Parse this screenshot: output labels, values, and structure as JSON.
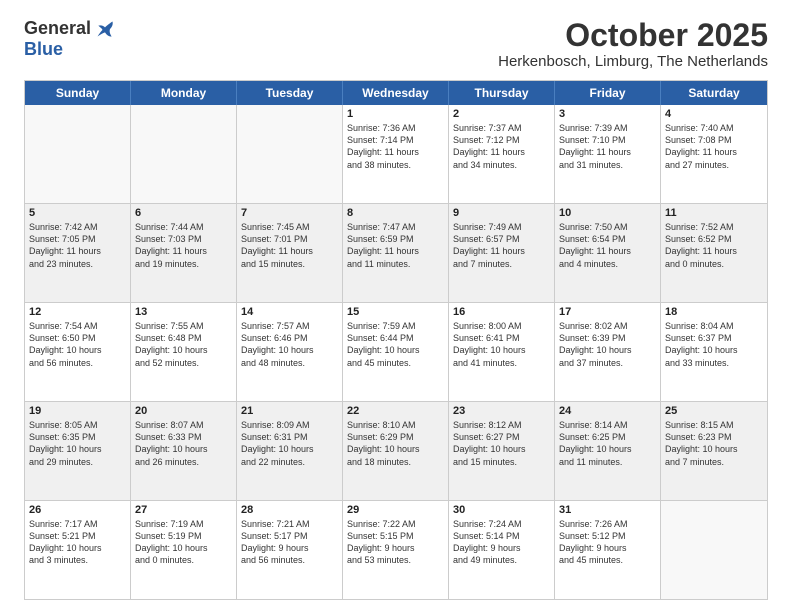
{
  "logo": {
    "general": "General",
    "blue": "Blue"
  },
  "title": "October 2025",
  "location": "Herkenbosch, Limburg, The Netherlands",
  "headers": [
    "Sunday",
    "Monday",
    "Tuesday",
    "Wednesday",
    "Thursday",
    "Friday",
    "Saturday"
  ],
  "weeks": [
    [
      {
        "day": "",
        "empty": true
      },
      {
        "day": "",
        "empty": true
      },
      {
        "day": "",
        "empty": true
      },
      {
        "day": "1",
        "lines": [
          "Sunrise: 7:36 AM",
          "Sunset: 7:14 PM",
          "Daylight: 11 hours",
          "and 38 minutes."
        ]
      },
      {
        "day": "2",
        "lines": [
          "Sunrise: 7:37 AM",
          "Sunset: 7:12 PM",
          "Daylight: 11 hours",
          "and 34 minutes."
        ]
      },
      {
        "day": "3",
        "lines": [
          "Sunrise: 7:39 AM",
          "Sunset: 7:10 PM",
          "Daylight: 11 hours",
          "and 31 minutes."
        ]
      },
      {
        "day": "4",
        "lines": [
          "Sunrise: 7:40 AM",
          "Sunset: 7:08 PM",
          "Daylight: 11 hours",
          "and 27 minutes."
        ]
      }
    ],
    [
      {
        "day": "5",
        "lines": [
          "Sunrise: 7:42 AM",
          "Sunset: 7:05 PM",
          "Daylight: 11 hours",
          "and 23 minutes."
        ]
      },
      {
        "day": "6",
        "lines": [
          "Sunrise: 7:44 AM",
          "Sunset: 7:03 PM",
          "Daylight: 11 hours",
          "and 19 minutes."
        ]
      },
      {
        "day": "7",
        "lines": [
          "Sunrise: 7:45 AM",
          "Sunset: 7:01 PM",
          "Daylight: 11 hours",
          "and 15 minutes."
        ]
      },
      {
        "day": "8",
        "lines": [
          "Sunrise: 7:47 AM",
          "Sunset: 6:59 PM",
          "Daylight: 11 hours",
          "and 11 minutes."
        ]
      },
      {
        "day": "9",
        "lines": [
          "Sunrise: 7:49 AM",
          "Sunset: 6:57 PM",
          "Daylight: 11 hours",
          "and 7 minutes."
        ]
      },
      {
        "day": "10",
        "lines": [
          "Sunrise: 7:50 AM",
          "Sunset: 6:54 PM",
          "Daylight: 11 hours",
          "and 4 minutes."
        ]
      },
      {
        "day": "11",
        "lines": [
          "Sunrise: 7:52 AM",
          "Sunset: 6:52 PM",
          "Daylight: 11 hours",
          "and 0 minutes."
        ]
      }
    ],
    [
      {
        "day": "12",
        "lines": [
          "Sunrise: 7:54 AM",
          "Sunset: 6:50 PM",
          "Daylight: 10 hours",
          "and 56 minutes."
        ]
      },
      {
        "day": "13",
        "lines": [
          "Sunrise: 7:55 AM",
          "Sunset: 6:48 PM",
          "Daylight: 10 hours",
          "and 52 minutes."
        ]
      },
      {
        "day": "14",
        "lines": [
          "Sunrise: 7:57 AM",
          "Sunset: 6:46 PM",
          "Daylight: 10 hours",
          "and 48 minutes."
        ]
      },
      {
        "day": "15",
        "lines": [
          "Sunrise: 7:59 AM",
          "Sunset: 6:44 PM",
          "Daylight: 10 hours",
          "and 45 minutes."
        ]
      },
      {
        "day": "16",
        "lines": [
          "Sunrise: 8:00 AM",
          "Sunset: 6:41 PM",
          "Daylight: 10 hours",
          "and 41 minutes."
        ]
      },
      {
        "day": "17",
        "lines": [
          "Sunrise: 8:02 AM",
          "Sunset: 6:39 PM",
          "Daylight: 10 hours",
          "and 37 minutes."
        ]
      },
      {
        "day": "18",
        "lines": [
          "Sunrise: 8:04 AM",
          "Sunset: 6:37 PM",
          "Daylight: 10 hours",
          "and 33 minutes."
        ]
      }
    ],
    [
      {
        "day": "19",
        "lines": [
          "Sunrise: 8:05 AM",
          "Sunset: 6:35 PM",
          "Daylight: 10 hours",
          "and 29 minutes."
        ]
      },
      {
        "day": "20",
        "lines": [
          "Sunrise: 8:07 AM",
          "Sunset: 6:33 PM",
          "Daylight: 10 hours",
          "and 26 minutes."
        ]
      },
      {
        "day": "21",
        "lines": [
          "Sunrise: 8:09 AM",
          "Sunset: 6:31 PM",
          "Daylight: 10 hours",
          "and 22 minutes."
        ]
      },
      {
        "day": "22",
        "lines": [
          "Sunrise: 8:10 AM",
          "Sunset: 6:29 PM",
          "Daylight: 10 hours",
          "and 18 minutes."
        ]
      },
      {
        "day": "23",
        "lines": [
          "Sunrise: 8:12 AM",
          "Sunset: 6:27 PM",
          "Daylight: 10 hours",
          "and 15 minutes."
        ]
      },
      {
        "day": "24",
        "lines": [
          "Sunrise: 8:14 AM",
          "Sunset: 6:25 PM",
          "Daylight: 10 hours",
          "and 11 minutes."
        ]
      },
      {
        "day": "25",
        "lines": [
          "Sunrise: 8:15 AM",
          "Sunset: 6:23 PM",
          "Daylight: 10 hours",
          "and 7 minutes."
        ]
      }
    ],
    [
      {
        "day": "26",
        "lines": [
          "Sunrise: 7:17 AM",
          "Sunset: 5:21 PM",
          "Daylight: 10 hours",
          "and 3 minutes."
        ]
      },
      {
        "day": "27",
        "lines": [
          "Sunrise: 7:19 AM",
          "Sunset: 5:19 PM",
          "Daylight: 10 hours",
          "and 0 minutes."
        ]
      },
      {
        "day": "28",
        "lines": [
          "Sunrise: 7:21 AM",
          "Sunset: 5:17 PM",
          "Daylight: 9 hours",
          "and 56 minutes."
        ]
      },
      {
        "day": "29",
        "lines": [
          "Sunrise: 7:22 AM",
          "Sunset: 5:15 PM",
          "Daylight: 9 hours",
          "and 53 minutes."
        ]
      },
      {
        "day": "30",
        "lines": [
          "Sunrise: 7:24 AM",
          "Sunset: 5:14 PM",
          "Daylight: 9 hours",
          "and 49 minutes."
        ]
      },
      {
        "day": "31",
        "lines": [
          "Sunrise: 7:26 AM",
          "Sunset: 5:12 PM",
          "Daylight: 9 hours",
          "and 45 minutes."
        ]
      },
      {
        "day": "",
        "empty": true
      }
    ]
  ]
}
